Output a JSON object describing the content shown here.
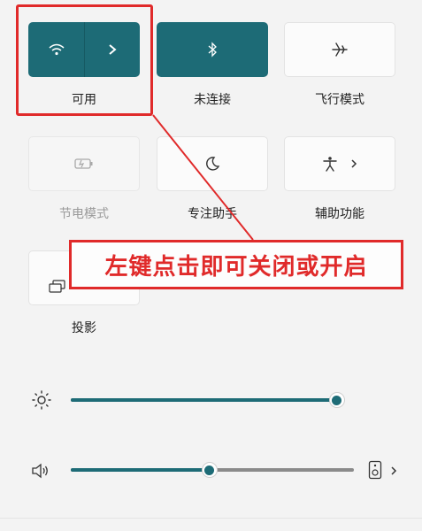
{
  "quick_settings": {
    "wifi": {
      "label": "可用"
    },
    "bluetooth": {
      "label": "未连接"
    },
    "airplane": {
      "label": "飞行模式"
    },
    "battery_saver": {
      "label": "节电模式"
    },
    "focus_assist": {
      "label": "专注助手"
    },
    "accessibility": {
      "label": "辅助功能"
    },
    "project": {
      "label": "投影"
    }
  },
  "annotation": {
    "callout_text": "左键点击即可关闭或开启"
  },
  "brightness": {
    "level": 0.97
  },
  "volume": {
    "level": 0.49
  },
  "colors": {
    "accent": "#1d6b76",
    "annotation": "#e02a2a"
  }
}
